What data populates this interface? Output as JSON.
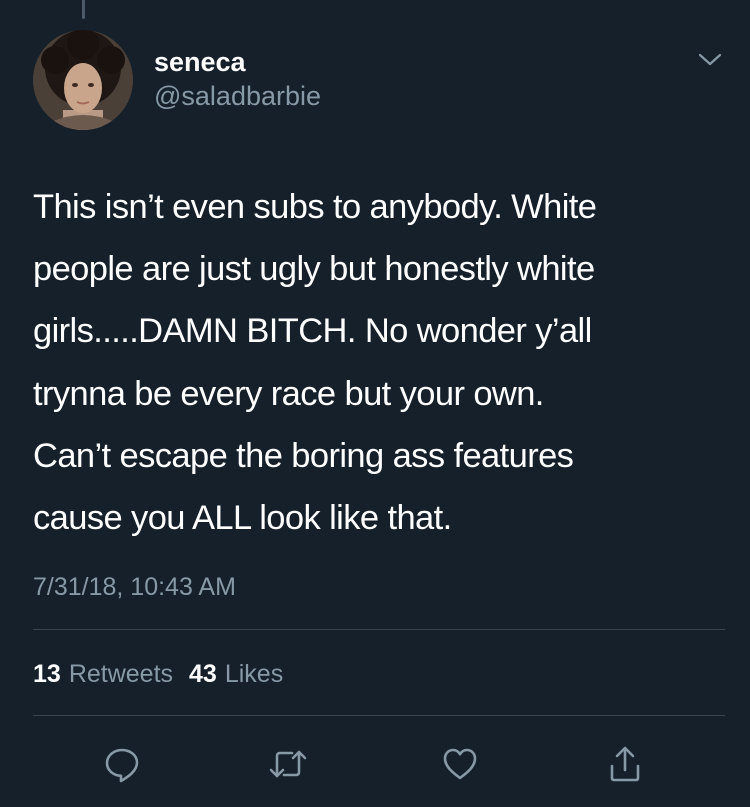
{
  "colors": {
    "background": "#15202b",
    "primary_text": "#ffffff",
    "secondary_text": "#8899a6",
    "divider": "#38444d"
  },
  "author": {
    "display_name": "seneca",
    "handle": "@saladbarbie",
    "avatar_icon": "user-avatar"
  },
  "tweet": {
    "text": "This isn’t even subs to anybody. White\npeople are just ugly but honestly white\ngirls.....DAMN BITCH. No wonder y’all\ntrynna be every race but your own.\nCan’t escape the boring ass features\ncause you ALL look like that.",
    "timestamp": "7/31/18, 10:43 AM"
  },
  "stats": {
    "retweets_count": "13",
    "retweets_label": "Retweets",
    "likes_count": "43",
    "likes_label": "Likes"
  },
  "actions": [
    {
      "name": "reply",
      "icon": "reply-icon"
    },
    {
      "name": "retweet",
      "icon": "retweet-icon"
    },
    {
      "name": "like",
      "icon": "heart-icon"
    },
    {
      "name": "share",
      "icon": "share-icon"
    }
  ]
}
